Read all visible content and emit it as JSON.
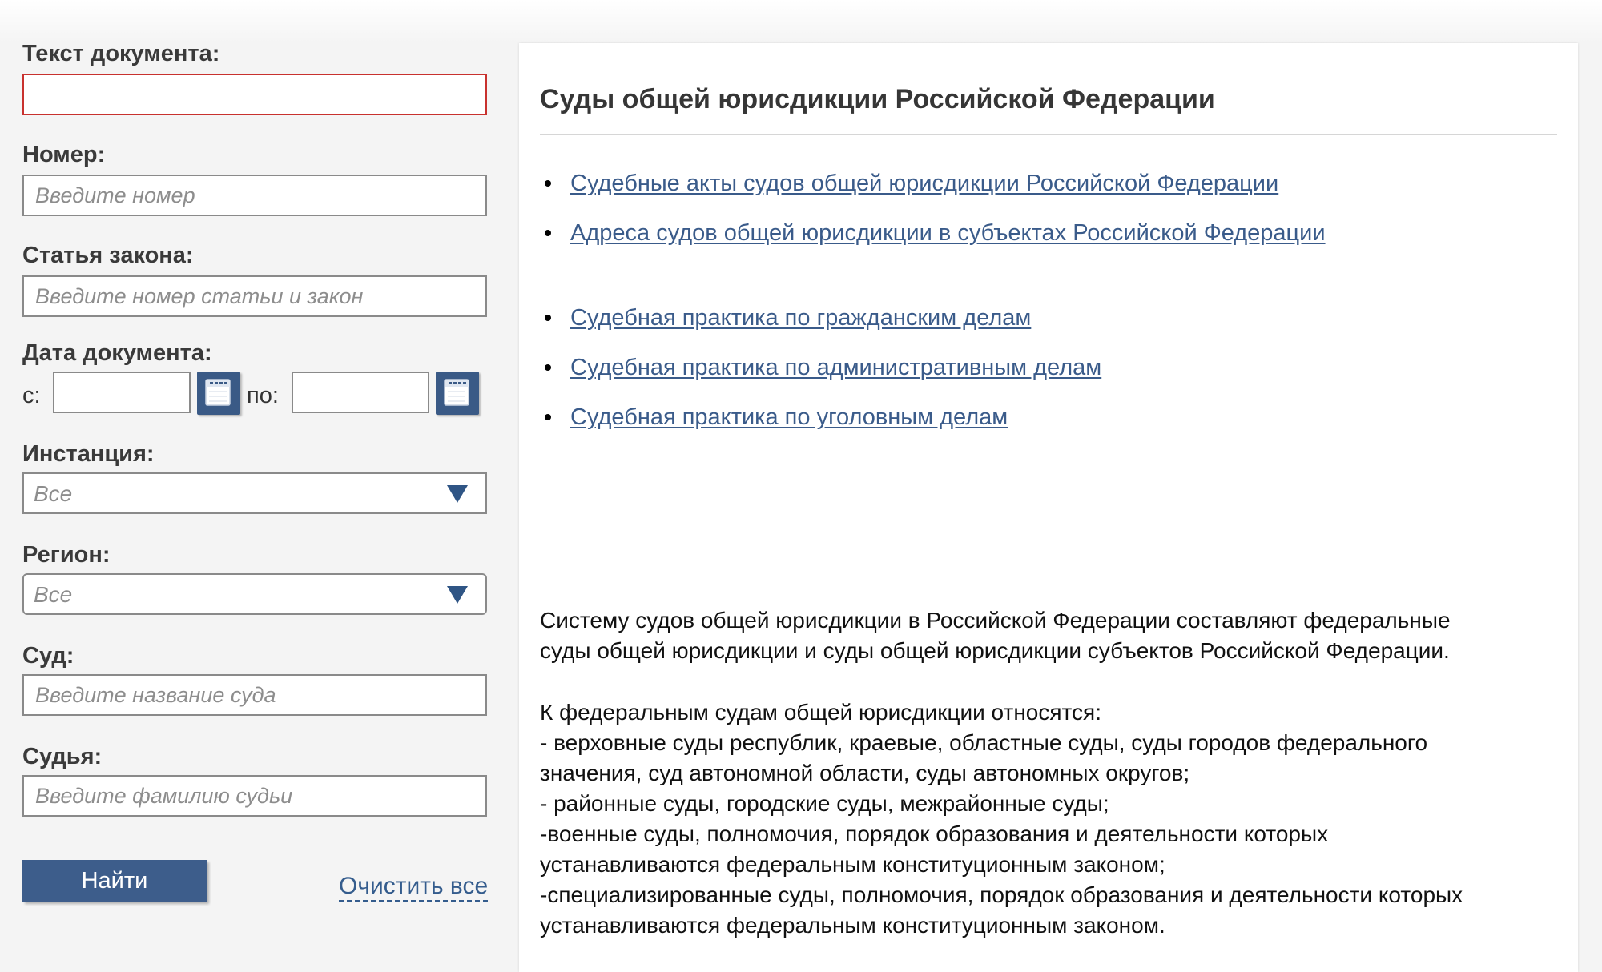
{
  "form": {
    "doc_text_label": "Текст документа:",
    "doc_text_value": "",
    "number_label": "Номер:",
    "number_placeholder": "Введите номер",
    "article_label": "Статья закона:",
    "article_placeholder": "Введите номер статьи и закон",
    "date_label": "Дата документа:",
    "date_from_label": "с:",
    "date_to_label": "по:",
    "instance_label": "Инстанция:",
    "instance_value": "Все",
    "region_label": "Регион:",
    "region_value": "Все",
    "court_label": "Суд:",
    "court_placeholder": "Введите название суда",
    "judge_label": "Судья:",
    "judge_placeholder": "Введите фамилию судьи",
    "search_button": "Найти",
    "clear_link": "Очистить все"
  },
  "panel": {
    "title": "Суды общей юрисдикции Российской Федерации",
    "links": [
      "Судебные акты судов общей юрисдикции Российской Федерации",
      "Адреса судов общей юрисдикции в субъектах Российской Федерации",
      "Судебная практика по гражданским делам",
      "Судебная практика по административным делам",
      "Судебная практика по уголовным делам"
    ],
    "description_lines": [
      "Систему судов общей юрисдикции в Российской Федерации составляют федеральные",
      "суды общей юрисдикции и суды общей юрисдикции субъектов Российской Федерации.",
      "К федеральным судам общей юрисдикции относятся:",
      "- верховные суды республик, краевые, областные суды, суды городов федерального",
      "значения, суд автономной области, суды автономных округов;",
      "- районные суды, городские суды, межрайонные суды;",
      "-военные суды, полномочия, порядок образования и деятельности которых",
      "устанавливаются федеральным конституционным законом;",
      "-специализированные суды, полномочия, порядок образования и деятельности которых",
      "устанавливаются федеральным конституционным законом."
    ]
  },
  "colors": {
    "accent_blue": "#3d5d8b",
    "link_blue": "#3a5b8a",
    "error_border": "#c8312e",
    "background": "#f4f4f4"
  },
  "icons": {
    "calendar": "calendar-icon",
    "dropdown": "chevron-down-icon"
  }
}
